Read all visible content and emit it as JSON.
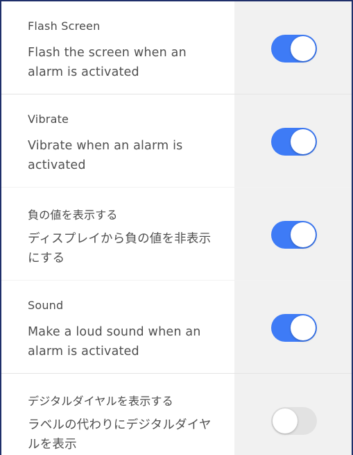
{
  "colors": {
    "toggle_on": "#3e7bf6",
    "toggle_off": "#e2e2e2",
    "text": "#4a4a4a",
    "right_panel": "#f1f1f1",
    "frame_border": "#1f2f6a"
  },
  "settings": [
    {
      "title": "Flash Screen",
      "description": "Flash the screen when an alarm is activated",
      "enabled": true
    },
    {
      "title": "Vibrate",
      "description": "Vibrate when an alarm is activated",
      "enabled": true
    },
    {
      "title": "負の値を表示する",
      "description": "ディスプレイから負の値を非表示にする",
      "enabled": true
    },
    {
      "title": "Sound",
      "description": "Make a loud sound when an alarm is activated",
      "enabled": true
    },
    {
      "title": "デジタルダイヤルを表示する",
      "description": "ラベルの代わりにデジタルダイヤルを表示",
      "enabled": false
    }
  ]
}
